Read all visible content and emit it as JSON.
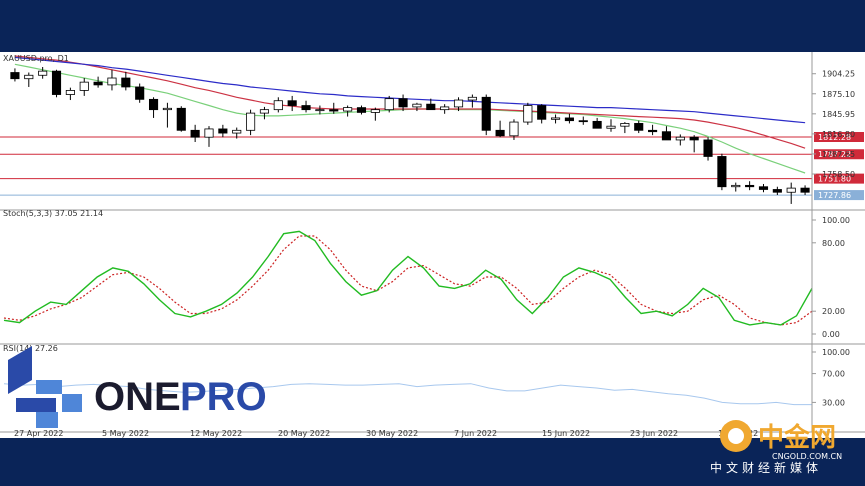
{
  "instrument_label": "XAUUSD.pro, D1",
  "stoch_label": "Stoch(5,3,3) 37.05 21.14",
  "rsi_label": "RSI(14) 27.26",
  "brand": {
    "name_part1": "ONE",
    "name_part2": "PRO",
    "color_blue": "#2a4aa8",
    "color_dark": "#1b1b2e"
  },
  "footer": {
    "site": "中金网",
    "domain": "CNGOLD.COM.CN",
    "tagline": "中文财经新媒体"
  },
  "colors": {
    "bg": "#0a2458",
    "bull": "#ffffff",
    "bear": "#000000",
    "ma_blue": "#2c2cc8",
    "ma_red": "#cc3344",
    "ma_green": "#7ad07a",
    "stoch_main": "#22bb22",
    "stoch_signal": "#cc2222",
    "rsi": "#a8c8ee",
    "level_red": "#d02a3a",
    "level_blue": "#8ab0d8"
  },
  "chart_data": {
    "type": "candlestick",
    "price_axis_ticks": [
      "1904.25",
      "1875.10",
      "1845.95",
      "1816.80",
      "1787.65",
      "1758.50"
    ],
    "price_range": [
      1712,
      1930
    ],
    "level_badges": [
      {
        "label": "1812.28",
        "value": 1812.28,
        "color": "#d02a3a"
      },
      {
        "label": "1787.22",
        "value": 1787.22,
        "color": "#d02a3a"
      },
      {
        "label": "1751.80",
        "value": 1751.8,
        "color": "#d02a3a"
      },
      {
        "label": "1727.86",
        "value": 1727.86,
        "color": "#8ab0d8"
      }
    ],
    "date_labels": [
      "27 Apr 2022",
      "5 May 2022",
      "12 May 2022",
      "20 May 2022",
      "30 May 2022",
      "7 Jun 2022",
      "15 Jun 2022",
      "23 Jun 2022",
      "1 Jul 2022"
    ],
    "candles": [
      {
        "o": 1906,
        "h": 1912,
        "l": 1893,
        "c": 1897
      },
      {
        "o": 1897,
        "h": 1906,
        "l": 1885,
        "c": 1902
      },
      {
        "o": 1902,
        "h": 1914,
        "l": 1897,
        "c": 1908
      },
      {
        "o": 1908,
        "h": 1910,
        "l": 1870,
        "c": 1874
      },
      {
        "o": 1874,
        "h": 1884,
        "l": 1866,
        "c": 1880
      },
      {
        "o": 1880,
        "h": 1898,
        "l": 1872,
        "c": 1892
      },
      {
        "o": 1892,
        "h": 1900,
        "l": 1884,
        "c": 1888
      },
      {
        "o": 1888,
        "h": 1910,
        "l": 1880,
        "c": 1898
      },
      {
        "o": 1898,
        "h": 1907,
        "l": 1880,
        "c": 1885
      },
      {
        "o": 1885,
        "h": 1890,
        "l": 1862,
        "c": 1867
      },
      {
        "o": 1867,
        "h": 1870,
        "l": 1840,
        "c": 1852
      },
      {
        "o": 1852,
        "h": 1862,
        "l": 1826,
        "c": 1854
      },
      {
        "o": 1854,
        "h": 1857,
        "l": 1820,
        "c": 1822
      },
      {
        "o": 1822,
        "h": 1830,
        "l": 1805,
        "c": 1812
      },
      {
        "o": 1812,
        "h": 1828,
        "l": 1798,
        "c": 1824
      },
      {
        "o": 1824,
        "h": 1830,
        "l": 1812,
        "c": 1818
      },
      {
        "o": 1818,
        "h": 1826,
        "l": 1810,
        "c": 1822
      },
      {
        "o": 1822,
        "h": 1852,
        "l": 1815,
        "c": 1847
      },
      {
        "o": 1847,
        "h": 1856,
        "l": 1838,
        "c": 1852
      },
      {
        "o": 1852,
        "h": 1870,
        "l": 1848,
        "c": 1865
      },
      {
        "o": 1865,
        "h": 1872,
        "l": 1850,
        "c": 1858
      },
      {
        "o": 1858,
        "h": 1865,
        "l": 1848,
        "c": 1852
      },
      {
        "o": 1852,
        "h": 1858,
        "l": 1845,
        "c": 1852
      },
      {
        "o": 1852,
        "h": 1862,
        "l": 1846,
        "c": 1850
      },
      {
        "o": 1850,
        "h": 1858,
        "l": 1842,
        "c": 1855
      },
      {
        "o": 1855,
        "h": 1858,
        "l": 1845,
        "c": 1848
      },
      {
        "o": 1848,
        "h": 1855,
        "l": 1836,
        "c": 1852
      },
      {
        "o": 1852,
        "h": 1872,
        "l": 1848,
        "c": 1868
      },
      {
        "o": 1868,
        "h": 1874,
        "l": 1850,
        "c": 1856
      },
      {
        "o": 1856,
        "h": 1862,
        "l": 1850,
        "c": 1860
      },
      {
        "o": 1860,
        "h": 1868,
        "l": 1852,
        "c": 1852
      },
      {
        "o": 1852,
        "h": 1860,
        "l": 1846,
        "c": 1856
      },
      {
        "o": 1856,
        "h": 1870,
        "l": 1850,
        "c": 1866
      },
      {
        "o": 1866,
        "h": 1874,
        "l": 1855,
        "c": 1870
      },
      {
        "o": 1870,
        "h": 1874,
        "l": 1815,
        "c": 1822
      },
      {
        "o": 1822,
        "h": 1836,
        "l": 1812,
        "c": 1814
      },
      {
        "o": 1814,
        "h": 1838,
        "l": 1808,
        "c": 1834
      },
      {
        "o": 1834,
        "h": 1862,
        "l": 1830,
        "c": 1858
      },
      {
        "o": 1858,
        "h": 1860,
        "l": 1832,
        "c": 1838
      },
      {
        "o": 1838,
        "h": 1845,
        "l": 1832,
        "c": 1840
      },
      {
        "o": 1840,
        "h": 1846,
        "l": 1832,
        "c": 1836
      },
      {
        "o": 1836,
        "h": 1842,
        "l": 1830,
        "c": 1835
      },
      {
        "o": 1835,
        "h": 1840,
        "l": 1825,
        "c": 1825
      },
      {
        "o": 1825,
        "h": 1838,
        "l": 1820,
        "c": 1828
      },
      {
        "o": 1828,
        "h": 1834,
        "l": 1818,
        "c": 1832
      },
      {
        "o": 1832,
        "h": 1836,
        "l": 1818,
        "c": 1822
      },
      {
        "o": 1822,
        "h": 1830,
        "l": 1815,
        "c": 1820
      },
      {
        "o": 1820,
        "h": 1828,
        "l": 1808,
        "c": 1808
      },
      {
        "o": 1808,
        "h": 1816,
        "l": 1800,
        "c": 1812
      },
      {
        "o": 1812,
        "h": 1815,
        "l": 1790,
        "c": 1808
      },
      {
        "o": 1808,
        "h": 1812,
        "l": 1778,
        "c": 1784
      },
      {
        "o": 1784,
        "h": 1788,
        "l": 1735,
        "c": 1740
      },
      {
        "o": 1740,
        "h": 1746,
        "l": 1733,
        "c": 1742
      },
      {
        "o": 1742,
        "h": 1748,
        "l": 1735,
        "c": 1740
      },
      {
        "o": 1740,
        "h": 1744,
        "l": 1732,
        "c": 1736
      },
      {
        "o": 1736,
        "h": 1740,
        "l": 1728,
        "c": 1732
      },
      {
        "o": 1732,
        "h": 1746,
        "l": 1715,
        "c": 1738
      },
      {
        "o": 1738,
        "h": 1742,
        "l": 1728,
        "c": 1732
      }
    ],
    "ma_blue": [
      1928,
      1926,
      1924,
      1922,
      1920,
      1918,
      1916,
      1913,
      1911,
      1908,
      1905,
      1902,
      1899,
      1896,
      1893,
      1890,
      1888,
      1885,
      1883,
      1881,
      1879,
      1877,
      1875,
      1874,
      1872,
      1871,
      1870,
      1869,
      1868,
      1867,
      1866,
      1865,
      1865,
      1864,
      1863,
      1862,
      1861,
      1860,
      1859,
      1858,
      1857,
      1856,
      1855,
      1855,
      1854,
      1853,
      1852,
      1851,
      1850,
      1849,
      1847,
      1845,
      1843,
      1841,
      1839,
      1837,
      1835,
      1833
    ],
    "ma_red": [
      1930,
      1928,
      1926,
      1924,
      1921,
      1918,
      1914,
      1910,
      1906,
      1902,
      1898,
      1894,
      1889,
      1884,
      1880,
      1875,
      1870,
      1866,
      1862,
      1859,
      1857,
      1855,
      1854,
      1853,
      1853,
      1853,
      1853,
      1853,
      1853,
      1853,
      1853,
      1853,
      1853,
      1853,
      1853,
      1852,
      1851,
      1850,
      1849,
      1848,
      1847,
      1846,
      1845,
      1844,
      1843,
      1842,
      1841,
      1840,
      1839,
      1837,
      1834,
      1830,
      1826,
      1821,
      1815,
      1809,
      1803,
      1796
    ],
    "ma_green": [
      1918,
      1914,
      1910,
      1906,
      1902,
      1898,
      1894,
      1890,
      1887,
      1884,
      1880,
      1876,
      1870,
      1864,
      1858,
      1852,
      1847,
      1844,
      1843,
      1843,
      1844,
      1845,
      1846,
      1847,
      1848,
      1849,
      1850,
      1851,
      1852,
      1853,
      1853,
      1853,
      1852,
      1852,
      1852,
      1851,
      1850,
      1849,
      1848,
      1847,
      1846,
      1845,
      1843,
      1841,
      1839,
      1836,
      1833,
      1829,
      1825,
      1820,
      1813,
      1805,
      1796,
      1788,
      1781,
      1774,
      1767,
      1760
    ],
    "stoch_axis_ticks": [
      "100.00",
      "80.00",
      "20.00",
      "0.00"
    ],
    "stoch_main": [
      12,
      10,
      20,
      28,
      26,
      38,
      50,
      58,
      55,
      44,
      30,
      18,
      15,
      20,
      26,
      36,
      50,
      68,
      88,
      90,
      82,
      62,
      46,
      34,
      38,
      56,
      68,
      58,
      42,
      40,
      44,
      56,
      48,
      30,
      18,
      32,
      50,
      58,
      54,
      48,
      32,
      18,
      20,
      16,
      26,
      40,
      32,
      12,
      8,
      10,
      8,
      16,
      40
    ],
    "stoch_signal": [
      14,
      12,
      16,
      22,
      26,
      32,
      42,
      52,
      54,
      50,
      40,
      28,
      18,
      18,
      22,
      30,
      42,
      56,
      74,
      86,
      86,
      74,
      56,
      42,
      38,
      46,
      58,
      60,
      52,
      44,
      42,
      50,
      50,
      40,
      26,
      28,
      40,
      50,
      56,
      52,
      40,
      26,
      20,
      18,
      20,
      30,
      34,
      26,
      14,
      10,
      8,
      10,
      20
    ],
    "rsi_axis_ticks": [
      "100.00",
      "70.00",
      "30.00"
    ],
    "rsi": [
      56,
      54,
      55,
      52,
      54,
      55,
      53,
      52,
      48,
      46,
      44,
      45,
      47,
      48,
      50,
      52,
      55,
      56,
      55,
      54,
      54,
      55,
      56,
      52,
      54,
      55,
      56,
      50,
      46,
      46,
      50,
      54,
      52,
      50,
      47,
      48,
      45,
      42,
      40,
      36,
      30,
      28,
      28,
      30,
      27,
      27
    ]
  }
}
